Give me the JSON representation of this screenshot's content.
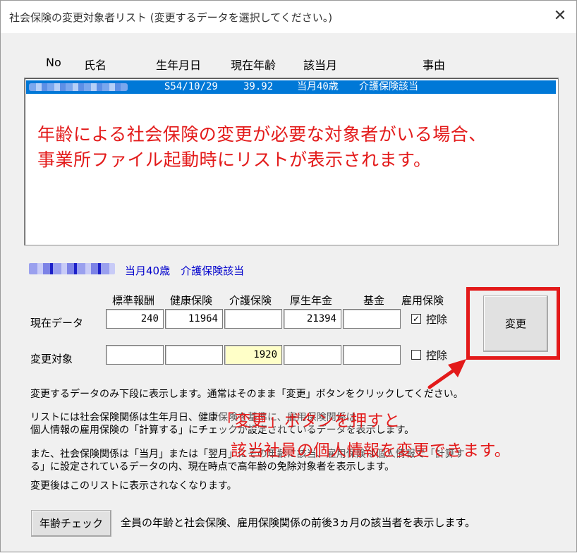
{
  "window": {
    "title": "社会保険の変更対象者リスト (変更するデータを選択してください。)",
    "close_glyph": "✕"
  },
  "list": {
    "headers": {
      "no": "No",
      "name": "氏名",
      "birth": "生年月日",
      "age": "現在年齢",
      "month": "該当月",
      "reason": "事由"
    },
    "rows": [
      {
        "birth": "S54/10/29",
        "age": "39.92",
        "month": "当月40歳",
        "reason": "介護保険該当"
      }
    ]
  },
  "annotation_top": {
    "line1": "年齢による社会保険の変更が必要な対象者がいる場合、",
    "line2": "事業所ファイル起動時にリストが表示されます。"
  },
  "selected_info": "当月40歳　介護保険該当",
  "grid": {
    "columns": [
      "標準報酬",
      "健康保険",
      "介護保険",
      "厚生年金",
      "基金",
      "雇用保険"
    ],
    "row_current": {
      "label": "現在データ",
      "values": [
        "240",
        "11964",
        "",
        "21394",
        ""
      ],
      "checkbox_label": "控除",
      "checked": true,
      "check_glyph": "✓"
    },
    "row_change": {
      "label": "変更対象",
      "values": [
        "",
        "",
        "1920",
        "",
        ""
      ],
      "checkbox_label": "控除",
      "checked": false
    }
  },
  "buttons": {
    "change": "変更",
    "age_check": "年齢チェック"
  },
  "desc": {
    "p1": "変更するデータのみ下段に表示します。通常はそのまま「変更」ボタンをクリックしてください。",
    "p2_l1": "リストには社会保険関係は生年月日、健康保険を基準に、雇用保険関係は",
    "p2_l2": "個人情報の雇用保険の「計算する」にチェックが設定されているデータを表示します。",
    "p3_l1": "また、社会保険関係は「当月」または「翌月」にその年齢に該当、雇用保険は個人情報で「計算す",
    "p3_l2": "る」に設定されているデータの内、現在時点で高年齢の免除対象者を表示します。",
    "p4": "変更後はこのリストに表示されなくなります。",
    "age_check_desc": "全員の年齢と社会保険、雇用保険関係の前後3ヵ月の該当者を表示します。"
  },
  "annotation_bottom": {
    "line1": "「変更」ボタンを押すと",
    "line2": "該当社員の個人情報を変更できます。"
  },
  "colors": {
    "annotation": "#e31a1a",
    "selection": "#0078d7",
    "info_text": "#0000cc",
    "highlight_field": "#ffffc8"
  }
}
